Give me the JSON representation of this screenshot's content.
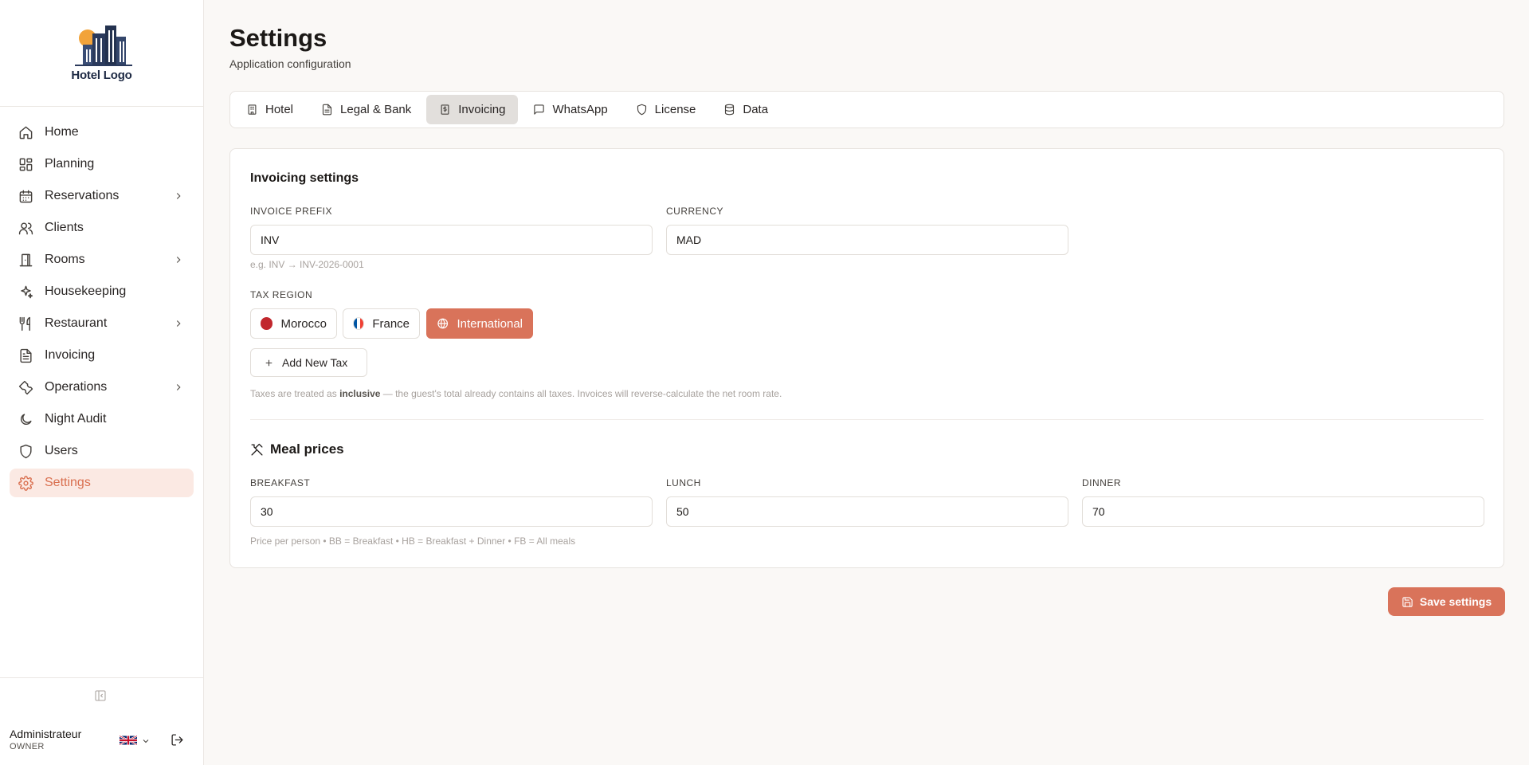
{
  "brand": {
    "logo_text": "Hotel Logo"
  },
  "sidebar": {
    "items": [
      {
        "label": "Home",
        "icon": "home-icon",
        "has_submenu": false,
        "active": false
      },
      {
        "label": "Planning",
        "icon": "grid-icon",
        "has_submenu": false,
        "active": false
      },
      {
        "label": "Reservations",
        "icon": "calendar-icon",
        "has_submenu": true,
        "active": false
      },
      {
        "label": "Clients",
        "icon": "users-icon",
        "has_submenu": false,
        "active": false
      },
      {
        "label": "Rooms",
        "icon": "door-icon",
        "has_submenu": true,
        "active": false
      },
      {
        "label": "Housekeeping",
        "icon": "sparkles-icon",
        "has_submenu": false,
        "active": false
      },
      {
        "label": "Restaurant",
        "icon": "utensils-icon",
        "has_submenu": true,
        "active": false
      },
      {
        "label": "Invoicing",
        "icon": "file-text-icon",
        "has_submenu": false,
        "active": false
      },
      {
        "label": "Operations",
        "icon": "wrench-icon",
        "has_submenu": true,
        "active": false
      },
      {
        "label": "Night Audit",
        "icon": "moon-icon",
        "has_submenu": false,
        "active": false
      },
      {
        "label": "Users",
        "icon": "shield-icon",
        "has_submenu": false,
        "active": false
      },
      {
        "label": "Settings",
        "icon": "gear-icon",
        "has_submenu": false,
        "active": true
      }
    ]
  },
  "user": {
    "name": "Administrateur",
    "role": "OWNER",
    "language": "uk-flag-icon"
  },
  "header": {
    "title": "Settings",
    "subtitle": "Application configuration"
  },
  "tabs": [
    {
      "label": "Hotel",
      "icon": "building-icon",
      "active": false
    },
    {
      "label": "Legal & Bank",
      "icon": "document-icon",
      "active": false
    },
    {
      "label": "Invoicing",
      "icon": "receipt-icon",
      "active": true
    },
    {
      "label": "WhatsApp",
      "icon": "message-icon",
      "active": false
    },
    {
      "label": "License",
      "icon": "shield-icon",
      "active": false
    },
    {
      "label": "Data",
      "icon": "database-icon",
      "active": false
    }
  ],
  "invoicing": {
    "title": "Invoicing settings",
    "prefix_label": "INVOICE PREFIX",
    "prefix_value": "INV",
    "prefix_hint": "e.g. INV → INV-2026-0001",
    "currency_label": "CURRENCY",
    "currency_value": "MAD",
    "tax_region_label": "TAX REGION",
    "regions": [
      {
        "label": "Morocco",
        "icon": "morocco-flag-icon",
        "active": false
      },
      {
        "label": "France",
        "icon": "france-flag-icon",
        "active": false
      },
      {
        "label": "International",
        "icon": "globe-icon",
        "active": true
      }
    ],
    "add_tax_label": "Add New Tax",
    "tax_note_prefix": "Taxes are treated as ",
    "tax_note_bold": "inclusive",
    "tax_note_suffix": " — the guest's total already contains all taxes. Invoices will reverse-calculate the net room rate."
  },
  "meals": {
    "title": "Meal prices",
    "breakfast_label": "BREAKFAST",
    "breakfast_value": "30",
    "lunch_label": "LUNCH",
    "lunch_value": "50",
    "dinner_label": "DINNER",
    "dinner_value": "70",
    "hint": "Price per person • BB = Breakfast • HB = Breakfast + Dinner • FB = All meals"
  },
  "actions": {
    "save_label": "Save settings"
  },
  "colors": {
    "accent": "#d9735a",
    "accent_bg": "#fbe9e3",
    "tab_active": "#e2dfdc"
  }
}
